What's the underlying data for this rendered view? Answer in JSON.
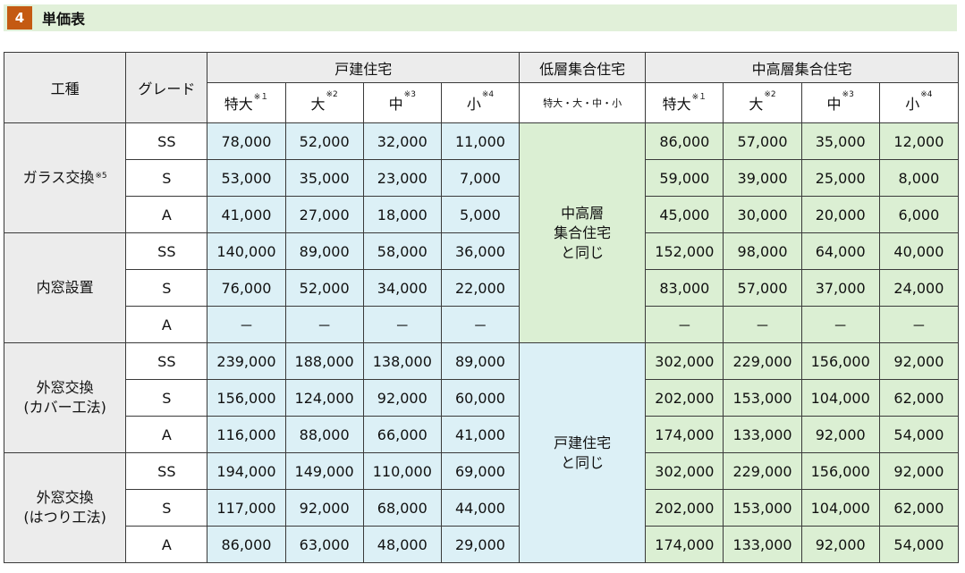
{
  "section": {
    "number": "4",
    "title": "単価表"
  },
  "headers": {
    "work_type": "工種",
    "grade": "グレード",
    "detached": "戸建住宅",
    "low_rise": "低層集合住宅",
    "mid_high": "中高層集合住宅",
    "sizes": [
      {
        "label": "特大",
        "note": "※１"
      },
      {
        "label": "大",
        "note": "※2"
      },
      {
        "label": "中",
        "note": "※3"
      },
      {
        "label": "小",
        "note": "※4"
      }
    ],
    "low_rise_sizes": "特大・大・中・小"
  },
  "low_rise_notes": {
    "same_as_mid_high": [
      "中高層",
      "集合住宅",
      "と同じ"
    ],
    "same_as_detached": [
      "戸建住宅",
      "と同じ"
    ]
  },
  "groups": [
    {
      "name_lines": [
        "ガラス交換"
      ],
      "name_note": "※5",
      "rows": [
        {
          "grade": "SS",
          "detached": [
            "78,000",
            "52,000",
            "32,000",
            "11,000"
          ],
          "mid_high": [
            "86,000",
            "57,000",
            "35,000",
            "12,000"
          ]
        },
        {
          "grade": "S",
          "detached": [
            "53,000",
            "35,000",
            "23,000",
            "7,000"
          ],
          "mid_high": [
            "59,000",
            "39,000",
            "25,000",
            "8,000"
          ]
        },
        {
          "grade": "A",
          "detached": [
            "41,000",
            "27,000",
            "18,000",
            "5,000"
          ],
          "mid_high": [
            "45,000",
            "30,000",
            "20,000",
            "6,000"
          ]
        }
      ]
    },
    {
      "name_lines": [
        "内窓設置"
      ],
      "name_note": "",
      "rows": [
        {
          "grade": "SS",
          "detached": [
            "140,000",
            "89,000",
            "58,000",
            "36,000"
          ],
          "mid_high": [
            "152,000",
            "98,000",
            "64,000",
            "40,000"
          ]
        },
        {
          "grade": "S",
          "detached": [
            "76,000",
            "52,000",
            "34,000",
            "22,000"
          ],
          "mid_high": [
            "83,000",
            "57,000",
            "37,000",
            "24,000"
          ]
        },
        {
          "grade": "A",
          "detached": [
            "－",
            "－",
            "－",
            "－"
          ],
          "mid_high": [
            "－",
            "－",
            "－",
            "－"
          ]
        }
      ]
    },
    {
      "name_lines": [
        "外窓交換",
        "(カバー工法)"
      ],
      "name_note": "",
      "rows": [
        {
          "grade": "SS",
          "detached": [
            "239,000",
            "188,000",
            "138,000",
            "89,000"
          ],
          "mid_high": [
            "302,000",
            "229,000",
            "156,000",
            "92,000"
          ]
        },
        {
          "grade": "S",
          "detached": [
            "156,000",
            "124,000",
            "92,000",
            "60,000"
          ],
          "mid_high": [
            "202,000",
            "153,000",
            "104,000",
            "62,000"
          ]
        },
        {
          "grade": "A",
          "detached": [
            "116,000",
            "88,000",
            "66,000",
            "41,000"
          ],
          "mid_high": [
            "174,000",
            "133,000",
            "92,000",
            "54,000"
          ]
        }
      ]
    },
    {
      "name_lines": [
        "外窓交換",
        "(はつり工法)"
      ],
      "name_note": "",
      "rows": [
        {
          "grade": "SS",
          "detached": [
            "194,000",
            "149,000",
            "110,000",
            "69,000"
          ],
          "mid_high": [
            "302,000",
            "229,000",
            "156,000",
            "92,000"
          ]
        },
        {
          "grade": "S",
          "detached": [
            "117,000",
            "92,000",
            "68,000",
            "44,000"
          ],
          "mid_high": [
            "202,000",
            "153,000",
            "104,000",
            "62,000"
          ]
        },
        {
          "grade": "A",
          "detached": [
            "86,000",
            "63,000",
            "48,000",
            "29,000"
          ],
          "mid_high": [
            "174,000",
            "133,000",
            "92,000",
            "54,000"
          ]
        }
      ]
    }
  ]
}
